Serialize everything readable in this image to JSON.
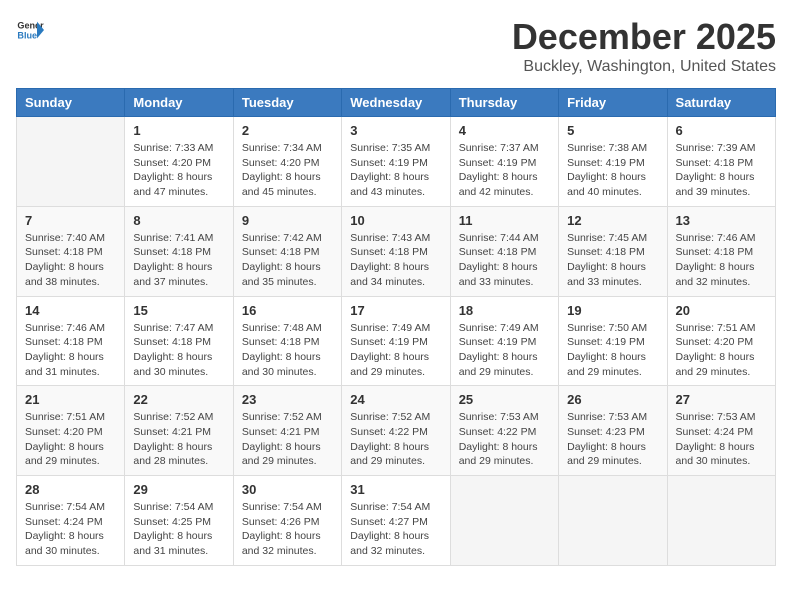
{
  "header": {
    "logo_general": "General",
    "logo_blue": "Blue",
    "month_title": "December 2025",
    "location": "Buckley, Washington, United States"
  },
  "days_of_week": [
    "Sunday",
    "Monday",
    "Tuesday",
    "Wednesday",
    "Thursday",
    "Friday",
    "Saturday"
  ],
  "weeks": [
    [
      {
        "day": "",
        "sunrise": "",
        "sunset": "",
        "daylight": ""
      },
      {
        "day": "1",
        "sunrise": "Sunrise: 7:33 AM",
        "sunset": "Sunset: 4:20 PM",
        "daylight": "Daylight: 8 hours and 47 minutes."
      },
      {
        "day": "2",
        "sunrise": "Sunrise: 7:34 AM",
        "sunset": "Sunset: 4:20 PM",
        "daylight": "Daylight: 8 hours and 45 minutes."
      },
      {
        "day": "3",
        "sunrise": "Sunrise: 7:35 AM",
        "sunset": "Sunset: 4:19 PM",
        "daylight": "Daylight: 8 hours and 43 minutes."
      },
      {
        "day": "4",
        "sunrise": "Sunrise: 7:37 AM",
        "sunset": "Sunset: 4:19 PM",
        "daylight": "Daylight: 8 hours and 42 minutes."
      },
      {
        "day": "5",
        "sunrise": "Sunrise: 7:38 AM",
        "sunset": "Sunset: 4:19 PM",
        "daylight": "Daylight: 8 hours and 40 minutes."
      },
      {
        "day": "6",
        "sunrise": "Sunrise: 7:39 AM",
        "sunset": "Sunset: 4:18 PM",
        "daylight": "Daylight: 8 hours and 39 minutes."
      }
    ],
    [
      {
        "day": "7",
        "sunrise": "Sunrise: 7:40 AM",
        "sunset": "Sunset: 4:18 PM",
        "daylight": "Daylight: 8 hours and 38 minutes."
      },
      {
        "day": "8",
        "sunrise": "Sunrise: 7:41 AM",
        "sunset": "Sunset: 4:18 PM",
        "daylight": "Daylight: 8 hours and 37 minutes."
      },
      {
        "day": "9",
        "sunrise": "Sunrise: 7:42 AM",
        "sunset": "Sunset: 4:18 PM",
        "daylight": "Daylight: 8 hours and 35 minutes."
      },
      {
        "day": "10",
        "sunrise": "Sunrise: 7:43 AM",
        "sunset": "Sunset: 4:18 PM",
        "daylight": "Daylight: 8 hours and 34 minutes."
      },
      {
        "day": "11",
        "sunrise": "Sunrise: 7:44 AM",
        "sunset": "Sunset: 4:18 PM",
        "daylight": "Daylight: 8 hours and 33 minutes."
      },
      {
        "day": "12",
        "sunrise": "Sunrise: 7:45 AM",
        "sunset": "Sunset: 4:18 PM",
        "daylight": "Daylight: 8 hours and 33 minutes."
      },
      {
        "day": "13",
        "sunrise": "Sunrise: 7:46 AM",
        "sunset": "Sunset: 4:18 PM",
        "daylight": "Daylight: 8 hours and 32 minutes."
      }
    ],
    [
      {
        "day": "14",
        "sunrise": "Sunrise: 7:46 AM",
        "sunset": "Sunset: 4:18 PM",
        "daylight": "Daylight: 8 hours and 31 minutes."
      },
      {
        "day": "15",
        "sunrise": "Sunrise: 7:47 AM",
        "sunset": "Sunset: 4:18 PM",
        "daylight": "Daylight: 8 hours and 30 minutes."
      },
      {
        "day": "16",
        "sunrise": "Sunrise: 7:48 AM",
        "sunset": "Sunset: 4:18 PM",
        "daylight": "Daylight: 8 hours and 30 minutes."
      },
      {
        "day": "17",
        "sunrise": "Sunrise: 7:49 AM",
        "sunset": "Sunset: 4:19 PM",
        "daylight": "Daylight: 8 hours and 29 minutes."
      },
      {
        "day": "18",
        "sunrise": "Sunrise: 7:49 AM",
        "sunset": "Sunset: 4:19 PM",
        "daylight": "Daylight: 8 hours and 29 minutes."
      },
      {
        "day": "19",
        "sunrise": "Sunrise: 7:50 AM",
        "sunset": "Sunset: 4:19 PM",
        "daylight": "Daylight: 8 hours and 29 minutes."
      },
      {
        "day": "20",
        "sunrise": "Sunrise: 7:51 AM",
        "sunset": "Sunset: 4:20 PM",
        "daylight": "Daylight: 8 hours and 29 minutes."
      }
    ],
    [
      {
        "day": "21",
        "sunrise": "Sunrise: 7:51 AM",
        "sunset": "Sunset: 4:20 PM",
        "daylight": "Daylight: 8 hours and 29 minutes."
      },
      {
        "day": "22",
        "sunrise": "Sunrise: 7:52 AM",
        "sunset": "Sunset: 4:21 PM",
        "daylight": "Daylight: 8 hours and 28 minutes."
      },
      {
        "day": "23",
        "sunrise": "Sunrise: 7:52 AM",
        "sunset": "Sunset: 4:21 PM",
        "daylight": "Daylight: 8 hours and 29 minutes."
      },
      {
        "day": "24",
        "sunrise": "Sunrise: 7:52 AM",
        "sunset": "Sunset: 4:22 PM",
        "daylight": "Daylight: 8 hours and 29 minutes."
      },
      {
        "day": "25",
        "sunrise": "Sunrise: 7:53 AM",
        "sunset": "Sunset: 4:22 PM",
        "daylight": "Daylight: 8 hours and 29 minutes."
      },
      {
        "day": "26",
        "sunrise": "Sunrise: 7:53 AM",
        "sunset": "Sunset: 4:23 PM",
        "daylight": "Daylight: 8 hours and 29 minutes."
      },
      {
        "day": "27",
        "sunrise": "Sunrise: 7:53 AM",
        "sunset": "Sunset: 4:24 PM",
        "daylight": "Daylight: 8 hours and 30 minutes."
      }
    ],
    [
      {
        "day": "28",
        "sunrise": "Sunrise: 7:54 AM",
        "sunset": "Sunset: 4:24 PM",
        "daylight": "Daylight: 8 hours and 30 minutes."
      },
      {
        "day": "29",
        "sunrise": "Sunrise: 7:54 AM",
        "sunset": "Sunset: 4:25 PM",
        "daylight": "Daylight: 8 hours and 31 minutes."
      },
      {
        "day": "30",
        "sunrise": "Sunrise: 7:54 AM",
        "sunset": "Sunset: 4:26 PM",
        "daylight": "Daylight: 8 hours and 32 minutes."
      },
      {
        "day": "31",
        "sunrise": "Sunrise: 7:54 AM",
        "sunset": "Sunset: 4:27 PM",
        "daylight": "Daylight: 8 hours and 32 minutes."
      },
      {
        "day": "",
        "sunrise": "",
        "sunset": "",
        "daylight": ""
      },
      {
        "day": "",
        "sunrise": "",
        "sunset": "",
        "daylight": ""
      },
      {
        "day": "",
        "sunrise": "",
        "sunset": "",
        "daylight": ""
      }
    ]
  ]
}
